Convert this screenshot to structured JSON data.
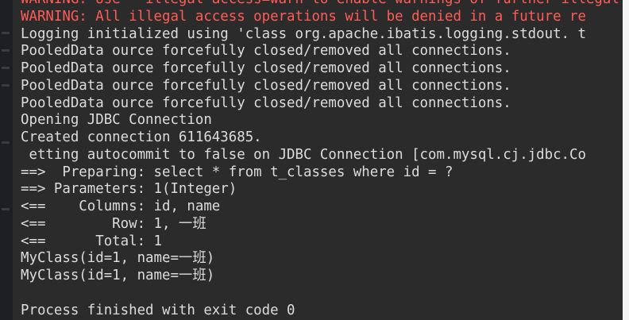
{
  "colors": {
    "console_background": "#2b2b2b",
    "normal_text": "#dcdcdc",
    "error_text": "#ff5c57",
    "gutter": "#1d1f22"
  },
  "console": {
    "lines": [
      {
        "text": "WARNING: Use --illegal-access=warn to enable warnings of further illegal",
        "kind": "error"
      },
      {
        "text": "WARNING: All illegal access operations will be denied in a future re",
        "kind": "error"
      },
      {
        "text": "Logging initialized using 'class org.apache.ibatis.logging.stdout. t",
        "kind": "normal"
      },
      {
        "text": "PooledData ource forcefully closed/removed all connections.",
        "kind": "normal"
      },
      {
        "text": "PooledData ource forcefully closed/removed all connections.",
        "kind": "normal"
      },
      {
        "text": "PooledData ource forcefully closed/removed all connections.",
        "kind": "normal"
      },
      {
        "text": "PooledData ource forcefully closed/removed all connections.",
        "kind": "normal"
      },
      {
        "text": "Opening JDBC Connection",
        "kind": "normal"
      },
      {
        "text": "Created connection 611643685.",
        "kind": "normal"
      },
      {
        "text": " etting autocommit to false on JDBC Connection [com.mysql.cj.jdbc.Co",
        "kind": "normal"
      },
      {
        "text": "==>  Preparing: select * from t_classes where id = ?",
        "kind": "normal"
      },
      {
        "text": "==> Parameters: 1(Integer)",
        "kind": "normal"
      },
      {
        "text": "<==    Columns: id, name",
        "kind": "normal"
      },
      {
        "text": "<==        Row: 1, 一班",
        "kind": "normal"
      },
      {
        "text": "<==      Total: 1",
        "kind": "normal"
      },
      {
        "text": "MyClass(id=1, name=一班)",
        "kind": "normal"
      },
      {
        "text": "MyClass(id=1, name=一班)",
        "kind": "normal"
      },
      {
        "text": "",
        "kind": "normal"
      },
      {
        "text": "Process finished with exit code 0",
        "kind": "normal"
      }
    ]
  }
}
